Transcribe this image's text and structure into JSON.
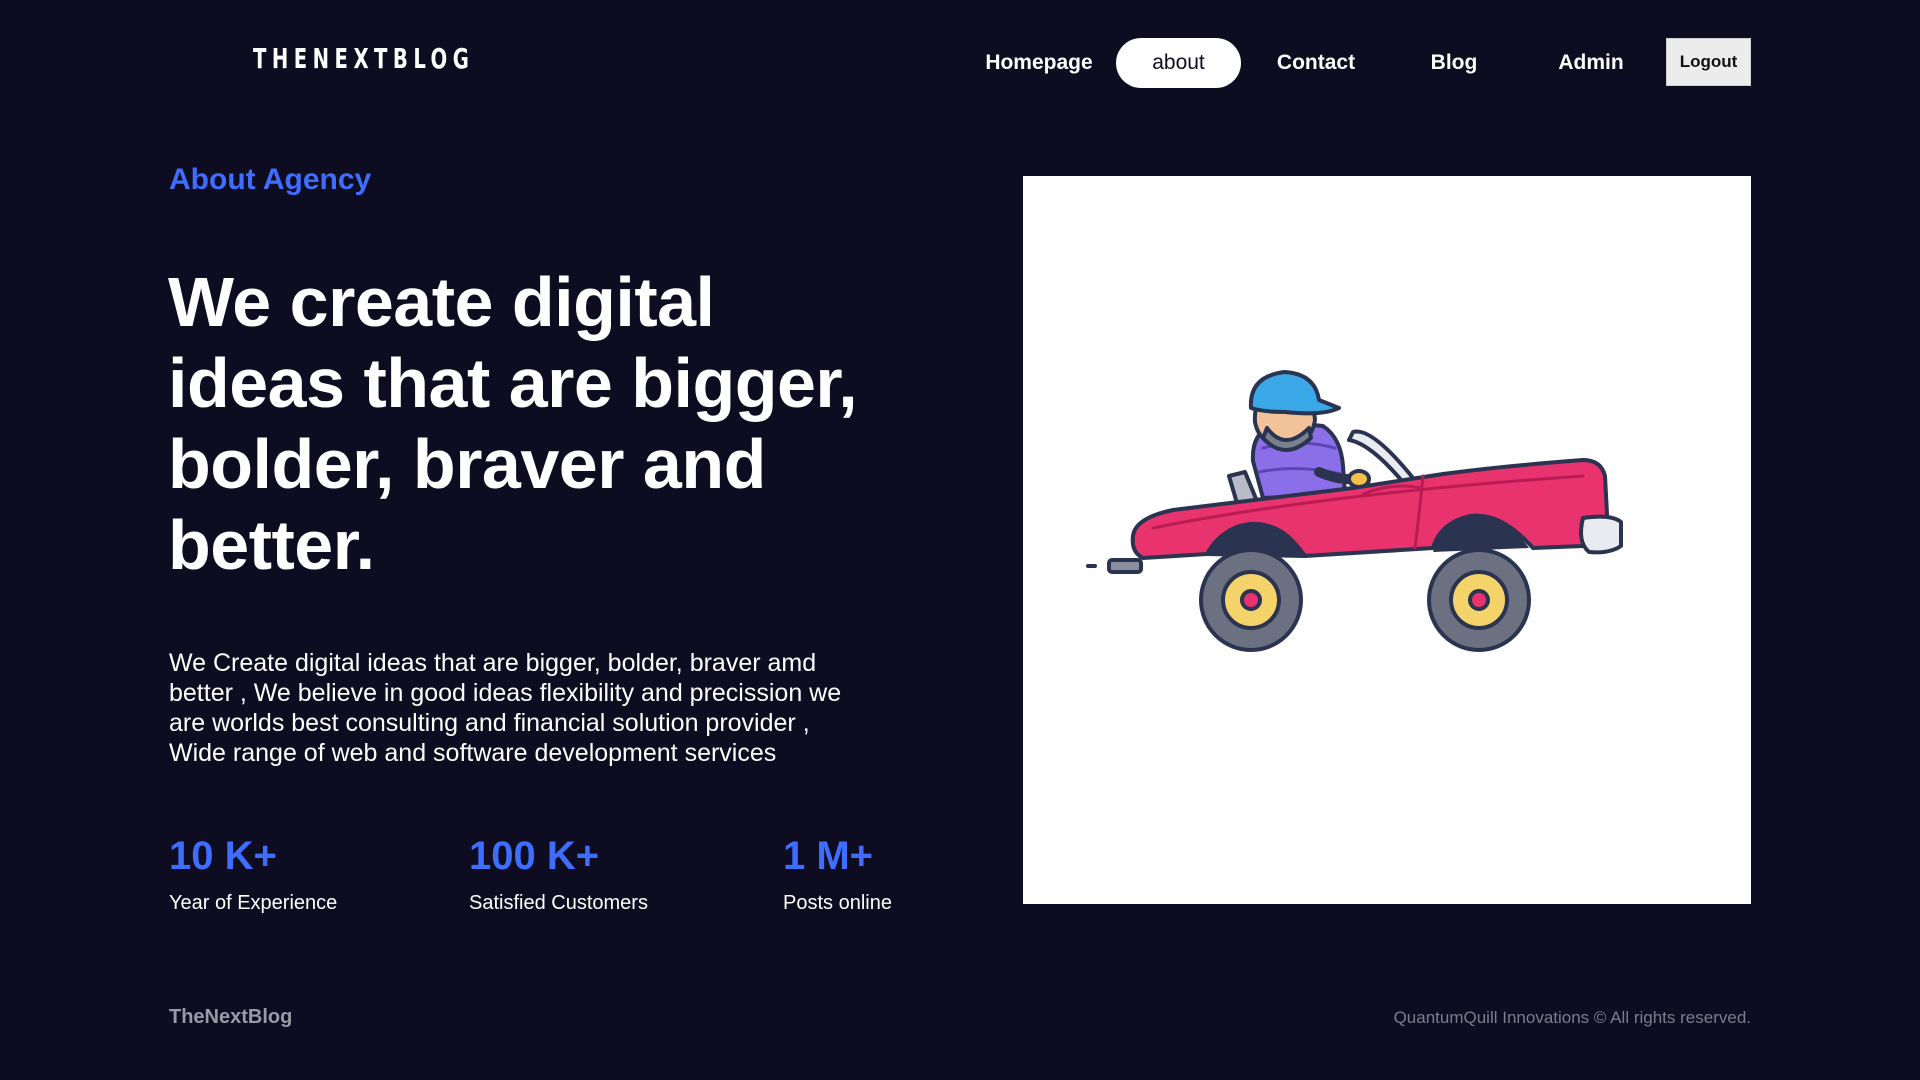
{
  "header": {
    "logo": "THENEXTBLOG",
    "nav": [
      "Homepage",
      "about",
      "Contact",
      "Blog",
      "Admin"
    ],
    "active_nav": "about",
    "logout_label": "Logout"
  },
  "hero": {
    "kicker": "About Agency",
    "headline_lines": [
      "We create digital",
      "ideas that are bigger,",
      "bolder, braver and",
      "better."
    ],
    "paragraph_lines": [
      "We Create digital ideas that are bigger, bolder, braver amd",
      "better , We believe in good ideas flexibility and precission we",
      "are worlds best consulting and financial solution provider ,",
      "Wide range of web and software development services"
    ]
  },
  "stats": [
    {
      "value": "10 K+",
      "label": "Year of Experience"
    },
    {
      "value": "100 K+",
      "label": "Satisfied Customers"
    },
    {
      "value": "1 M+",
      "label": "Posts online"
    }
  ],
  "illustration": {
    "icon": "car-driver-illustration",
    "colors": {
      "car_body": "#e8336e",
      "cap": "#3aa8e6",
      "jacket": "#8b6fe8",
      "wheel_hub": "#f4d36b",
      "tire": "#6c7181"
    }
  },
  "footer": {
    "brand": "TheNextBlog",
    "copyright": "QuantumQuill Innovations © All rights reserved."
  },
  "theme": {
    "background": "#0d0c21",
    "accent": "#3f6dff"
  }
}
